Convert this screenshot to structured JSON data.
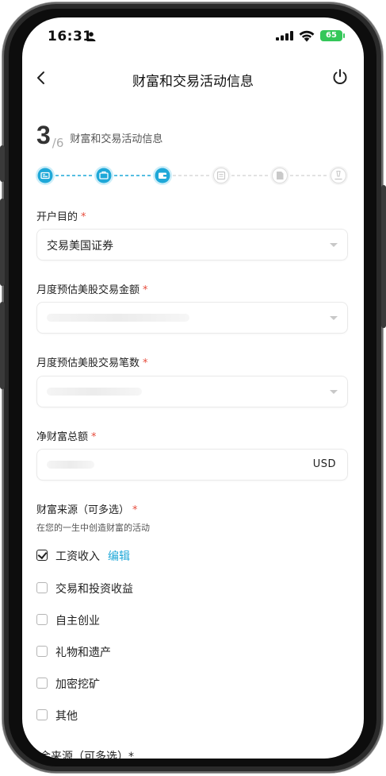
{
  "status_bar": {
    "time": "16:31",
    "battery": "65"
  },
  "nav": {
    "title": "财富和交易活动信息"
  },
  "step": {
    "current": "3",
    "total": "/6",
    "title": "财富和交易活动信息"
  },
  "progress": {
    "completed_steps": 3,
    "total_steps": 6,
    "accent": "#1fa8d8"
  },
  "form": {
    "purpose": {
      "label": "开户目的",
      "required": "*",
      "value": "交易美国证券"
    },
    "monthly_amount": {
      "label": "月度预估美股交易金额",
      "required": "*",
      "value": ""
    },
    "monthly_count": {
      "label": "月度预估美股交易笔数",
      "required": "*",
      "value": ""
    },
    "net_worth": {
      "label": "净财富总额",
      "required": "*",
      "value": "",
      "unit": "USD"
    },
    "wealth_source": {
      "label": "财富来源（可多选）",
      "required": "*",
      "subtext": "在您的一生中创造财富的活动",
      "edit_label": "编辑",
      "options": [
        {
          "label": "工资收入",
          "checked": true
        },
        {
          "label": "交易和投资收益",
          "checked": false
        },
        {
          "label": "自主创业",
          "checked": false
        },
        {
          "label": "礼物和遗产",
          "checked": false
        },
        {
          "label": "加密挖矿",
          "checked": false
        },
        {
          "label": "其他",
          "checked": false
        }
      ]
    },
    "next_section_label": "资金来源（可多选）*"
  }
}
